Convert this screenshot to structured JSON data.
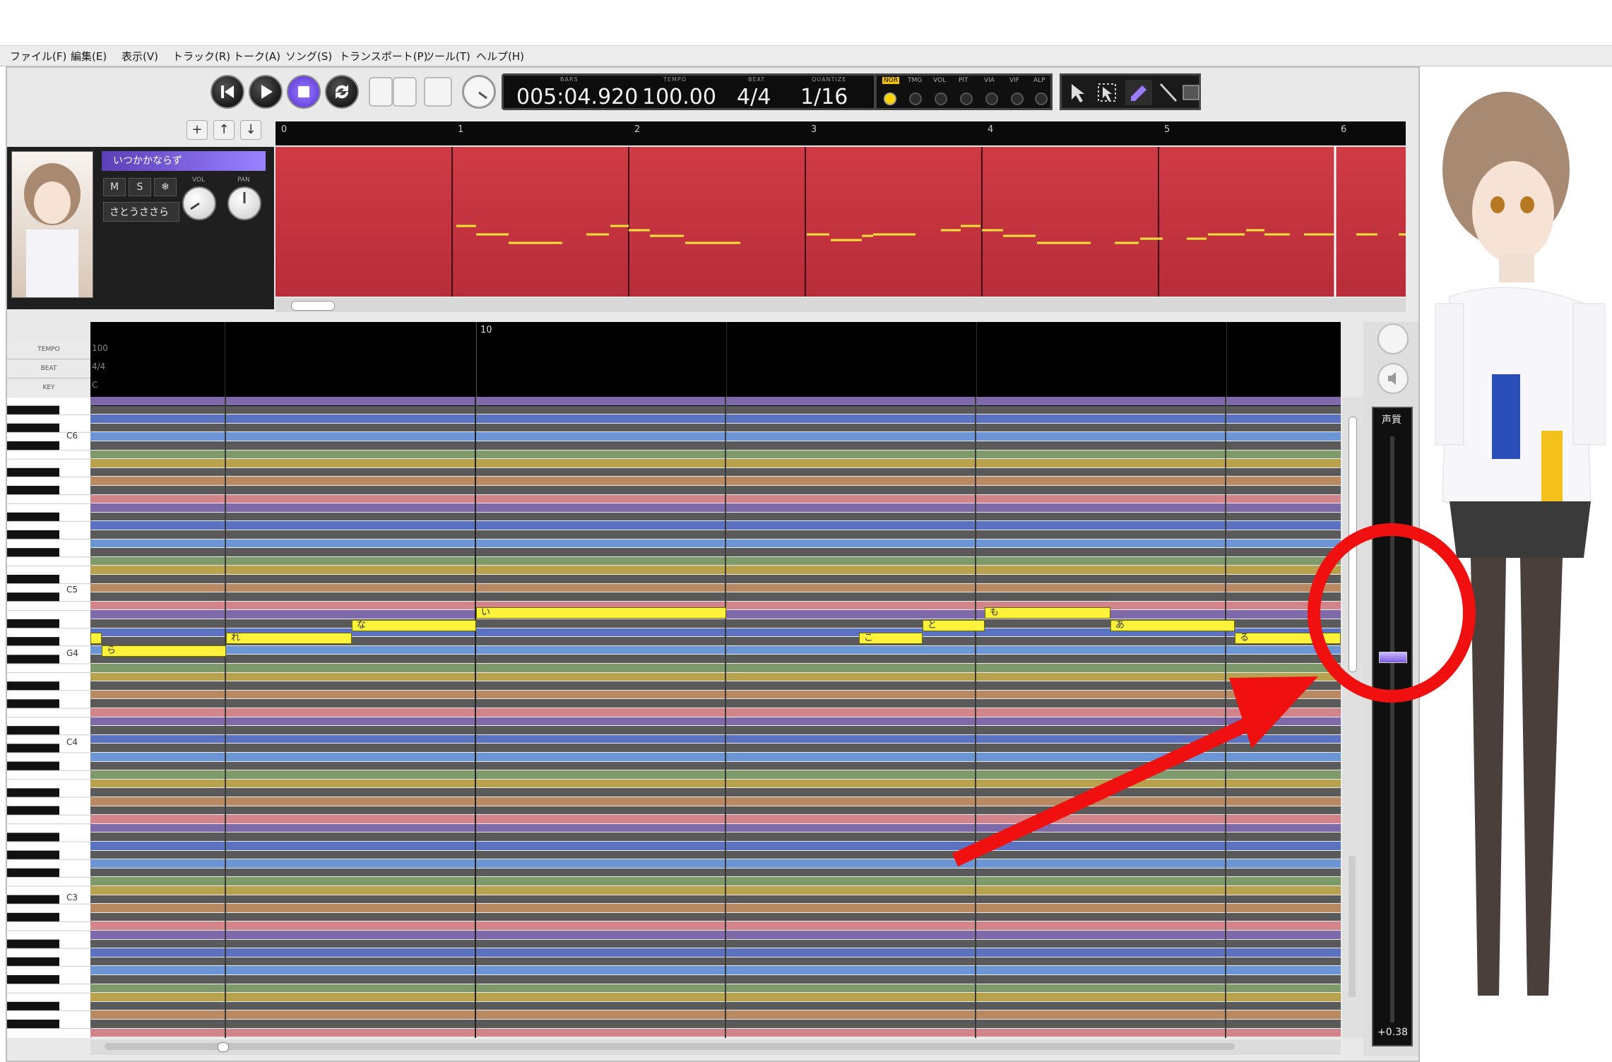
{
  "menu": [
    "ファイル(F)",
    "編集(E)",
    "表示(V)",
    "トラック(R)",
    "トーク(A)",
    "ソング(S)",
    "トランスポート(P)",
    "ツール(T)",
    "ヘルプ(H)"
  ],
  "lcd": {
    "bars_label": "BARS",
    "bars": "005:04.920",
    "tempo_label": "TEMPO",
    "tempo": "100.00",
    "beat_label": "BEAT",
    "beat": "4/4",
    "quantize_label": "QUANTIZE",
    "quantize": "1/16"
  },
  "modes": [
    "NOR",
    "TMG",
    "VOL",
    "PIT",
    "VIA",
    "VIF",
    "ALP"
  ],
  "track": {
    "name": "いつかかならず",
    "mute": "M",
    "solo": "S",
    "freeze": "❄",
    "vol_label": "VOL",
    "pan_label": "PAN",
    "singer": "さとうささら"
  },
  "song_ruler_ticks": [
    "0",
    "1",
    "2",
    "3",
    "4",
    "5",
    "6"
  ],
  "editor": {
    "tempo_label": "TEMPO",
    "tempo_value": "100",
    "beat_label": "BEAT",
    "beat_value": "4/4",
    "key_label": "KEY",
    "key_value": "C",
    "bar_number": "10",
    "octave_labels": [
      "C6",
      "C5",
      "G4",
      "C4",
      "C3"
    ]
  },
  "notes": [
    {
      "lyric": "ら"
    },
    {
      "lyric": "れ"
    },
    {
      "lyric": "な"
    },
    {
      "lyric": "い"
    },
    {
      "lyric": "こ"
    },
    {
      "lyric": "と"
    },
    {
      "lyric": "も"
    },
    {
      "lyric": "あ"
    },
    {
      "lyric": "る"
    }
  ],
  "voice_slider": {
    "label": "声質",
    "value": "+0.38",
    "position_fraction": 0.62
  },
  "colors": {
    "accent_purple": "#8a6cf0",
    "lane_red": "#c5323e",
    "note_yellow": "#fff23a",
    "annotation_red": "#f01010"
  }
}
